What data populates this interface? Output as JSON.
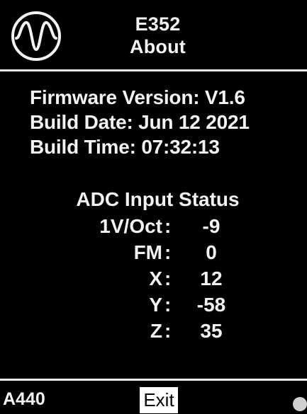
{
  "header": {
    "logo_icon": "sine-wave-logo-icon",
    "model": "E352",
    "page_title": "About"
  },
  "firmware": {
    "version_line": "Firmware Version: V1.6",
    "build_date_line": "Build Date: Jun 12 2021",
    "build_time_line": "Build Time: 07:32:13"
  },
  "adc": {
    "title": "ADC Input Status",
    "rows": [
      {
        "label": "1V/Oct",
        "colon": ":",
        "value": "-9"
      },
      {
        "label": "FM",
        "colon": ":",
        "value": "0"
      },
      {
        "label": "X",
        "colon": ":",
        "value": "12"
      },
      {
        "label": "Y",
        "colon": ":",
        "value": "-58"
      },
      {
        "label": "Z",
        "colon": ":",
        "value": "35"
      }
    ]
  },
  "footer": {
    "left_label": "A440",
    "exit_label": "Exit"
  },
  "colors": {
    "background": "#000000",
    "foreground": "#f2f2f2",
    "button_bg": "#ffffff",
    "button_fg": "#000000"
  }
}
